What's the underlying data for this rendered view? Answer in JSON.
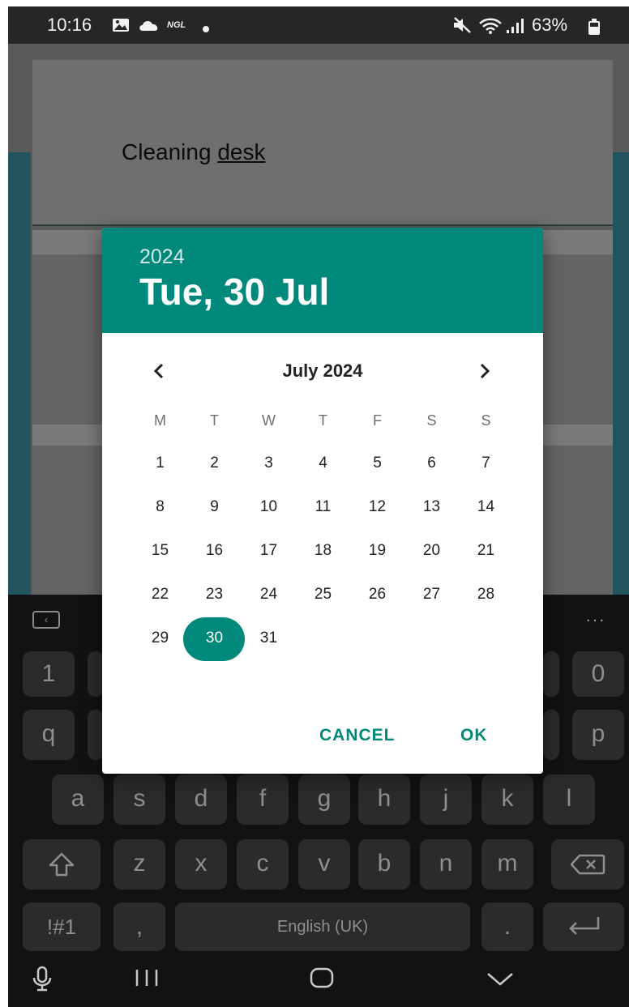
{
  "status_bar": {
    "time": "10:16",
    "carrier_tag": "NGL",
    "battery": "63%",
    "icons": [
      "gallery-icon",
      "cloud-icon",
      "dot-icon",
      "mute-icon",
      "wifi-icon",
      "signal-icon",
      "battery-icon"
    ]
  },
  "background_app": {
    "card_text_plain": "Cleaning ",
    "card_text_underlined": "desk"
  },
  "date_picker": {
    "selected_year": "2024",
    "selected_date": "Tue, 30 Jul",
    "month_label": "July 2024",
    "weekdays": [
      "M",
      "T",
      "W",
      "T",
      "F",
      "S",
      "S"
    ],
    "days": [
      "1",
      "2",
      "3",
      "4",
      "5",
      "6",
      "7",
      "8",
      "9",
      "10",
      "11",
      "12",
      "13",
      "14",
      "15",
      "16",
      "17",
      "18",
      "19",
      "20",
      "21",
      "22",
      "23",
      "24",
      "25",
      "26",
      "27",
      "28",
      "29",
      "30",
      "31"
    ],
    "first_weekday_index": 0,
    "selected_day": "30",
    "cancel_label": "CANCEL",
    "ok_label": "OK",
    "accent_color": "#00897b"
  },
  "keyboard": {
    "row1": [
      "1",
      "0"
    ],
    "row2": [
      "q",
      "p"
    ],
    "row3": [
      "a",
      "s",
      "d",
      "f",
      "g",
      "h",
      "j",
      "k",
      "l"
    ],
    "row4": [
      "z",
      "x",
      "c",
      "v",
      "b",
      "n",
      "m"
    ],
    "symbols_label": "!#1",
    "comma_label": ",",
    "space_label": "English (UK)",
    "period_label": ".",
    "more_label": "···"
  }
}
